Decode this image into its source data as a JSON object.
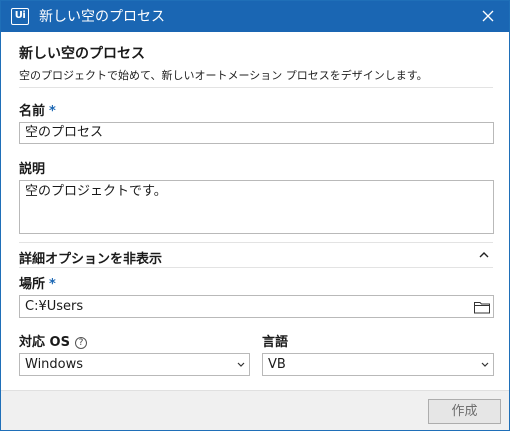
{
  "window": {
    "app_logo": "Ui",
    "title": "新しい空のプロセス",
    "close_icon": "close-icon"
  },
  "header": {
    "title": "新しい空のプロセス",
    "subtitle": "空のプロジェクトで始めて、新しいオートメーション プロセスをデザインします。"
  },
  "form": {
    "name_label": "名前",
    "required_mark": "*",
    "name_value": "空のプロセス",
    "description_label": "説明",
    "description_value": "空のプロジェクトです。",
    "advanced_toggle_label": "詳細オプションを非表示",
    "advanced_expanded": true,
    "location_label": "場所",
    "location_value": "C:¥Users",
    "target_os_label": "対応 OS",
    "help_icon_glyph": "?",
    "target_os_value": "Windows",
    "language_label": "言語",
    "language_value": "VB"
  },
  "footer": {
    "create_label": "作成",
    "create_enabled": false
  },
  "colors": {
    "titlebar": "#1a66b3",
    "required": "#1a66b3",
    "footer_bg": "#f0f0f0",
    "button_disabled_text": "#6d6d6d"
  }
}
